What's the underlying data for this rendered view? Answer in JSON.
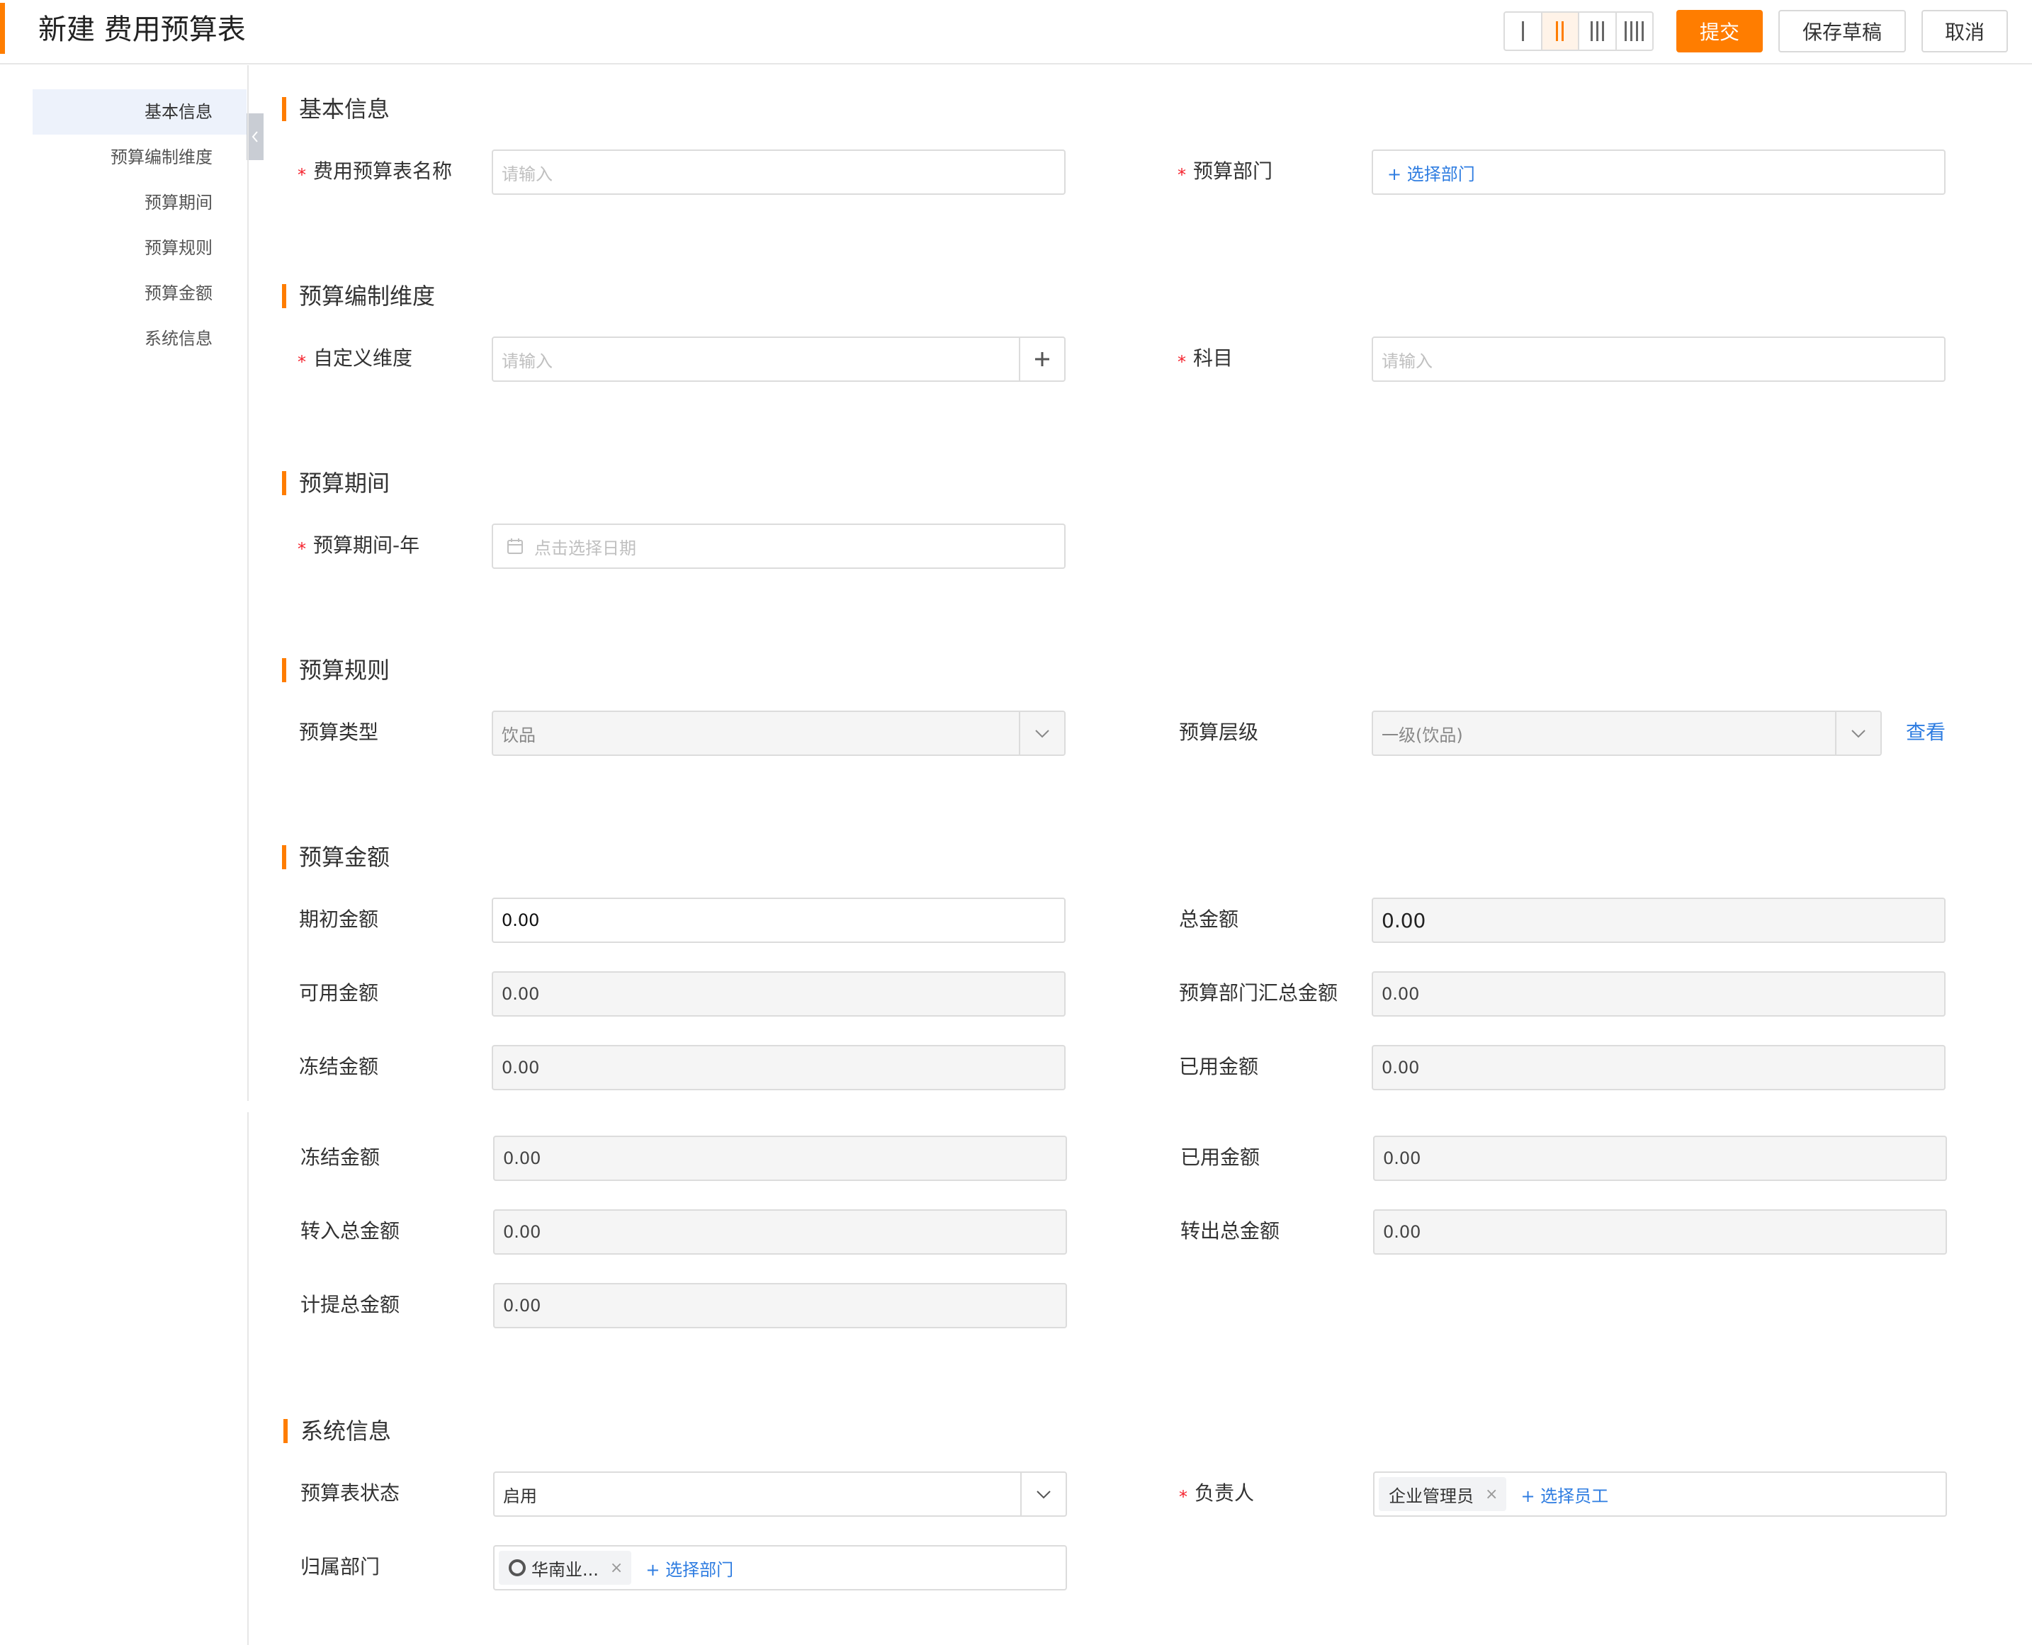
{
  "header": {
    "title": "新建 费用预算表",
    "submit_label": "提交",
    "save_draft_label": "保存草稿",
    "cancel_label": "取消"
  },
  "sidebar": {
    "items": [
      {
        "label": "基本信息"
      },
      {
        "label": "预算编制维度"
      },
      {
        "label": "预算期间"
      },
      {
        "label": "预算规则"
      },
      {
        "label": "预算金额"
      },
      {
        "label": "系统信息"
      }
    ]
  },
  "sections": {
    "basic": {
      "title": "基本信息",
      "name_label": "费用预算表名称",
      "name_placeholder": "请输入",
      "dept_label": "预算部门",
      "dept_link": "+ 选择部门"
    },
    "dimension": {
      "title": "预算编制维度",
      "custom_label": "自定义维度",
      "custom_placeholder": "请输入",
      "subject_label": "科目",
      "subject_placeholder": "请输入"
    },
    "period": {
      "title": "预算期间",
      "year_label": "预算期间-年",
      "year_placeholder": "点击选择日期"
    },
    "rule": {
      "title": "预算规则",
      "type_label": "预算类型",
      "type_value": "饮品",
      "level_label": "预算层级",
      "level_value": "一级(饮品)",
      "view_link": "查看"
    },
    "amount": {
      "title": "预算金额",
      "initial_label": "期初金额",
      "initial_value": "0.00",
      "total_label": "总金额",
      "total_value": "0.00",
      "available_label": "可用金额",
      "available_value": "0.00",
      "dept_total_label": "预算部门汇总金额",
      "dept_total_value": "0.00",
      "frozen_label": "冻结金额",
      "frozen_value": "0.00",
      "used_label": "已用金额",
      "used_value": "0.00",
      "frozen2_label": "冻结金额",
      "frozen2_value": "0.00",
      "used2_label": "已用金额",
      "used2_value": "0.00",
      "transfer_in_label": "转入总金额",
      "transfer_in_value": "0.00",
      "transfer_out_label": "转出总金额",
      "transfer_out_value": "0.00",
      "accrual_label": "计提总金额",
      "accrual_value": "0.00"
    },
    "system": {
      "title": "系统信息",
      "status_label": "预算表状态",
      "status_value": "启用",
      "owner_label": "负责人",
      "owner_tag": "企业管理员",
      "owner_link": "+ 选择员工",
      "dept_label": "归属部门",
      "dept_tag": "华南业...",
      "dept_link": "+ 选择部门"
    }
  },
  "colors": {
    "accent": "#ff7d00",
    "link": "#2f7de1",
    "required": "#f5222d",
    "nav_active_bg": "#edf2fb"
  }
}
